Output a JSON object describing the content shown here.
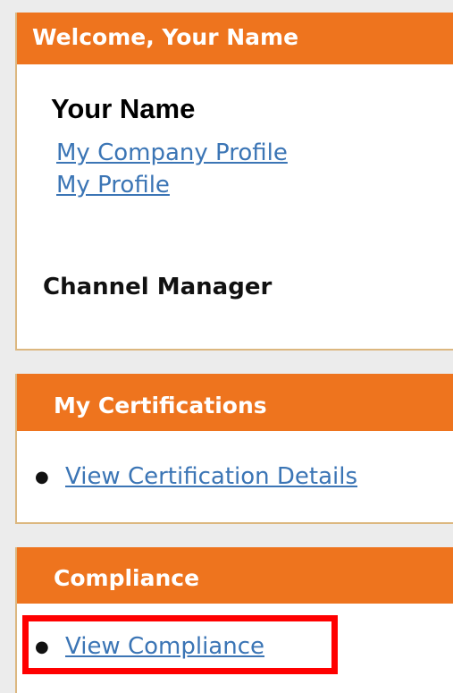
{
  "welcome_panel": {
    "header": "Welcome, Your Name",
    "user_name": "Your Name",
    "links": [
      "My Company Profile",
      "My Profile"
    ],
    "role": "Channel Manager"
  },
  "certifications_panel": {
    "header": "My Certifications",
    "link": "View Certification Details"
  },
  "compliance_panel": {
    "header": "Compliance",
    "link": "View Compliance"
  },
  "colors": {
    "header_bg": "#ee741e",
    "link": "#3b75b5",
    "highlight": "#ff0000",
    "panel_border": "#dcb77f"
  }
}
